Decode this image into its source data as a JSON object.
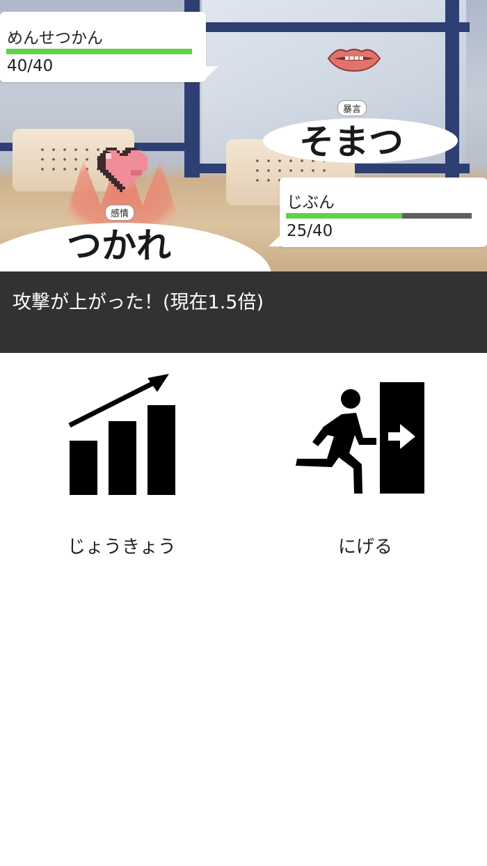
{
  "enemy": {
    "name": "めんせつかん",
    "hp_text": "40/40",
    "hp_fraction": 1.0,
    "attack_tag": "暴言",
    "attack_name": "そまつ"
  },
  "player": {
    "name": "じぶん",
    "hp_text": "25/40",
    "hp_fraction": 0.625,
    "emotion_tag": "感情",
    "emotion_name": "つかれ"
  },
  "message": "攻撃が上がった！(現在1.5倍)",
  "commands": [
    {
      "label": "じょうきょう",
      "icon": "bar-chart-rising-icon"
    },
    {
      "label": "にげる",
      "icon": "emergency-exit-icon"
    }
  ],
  "colors": {
    "hp_fill": "#5fd24a",
    "hp_empty": "#5f5f5f",
    "message_bg": "#323232",
    "heart": "#f08d98"
  }
}
